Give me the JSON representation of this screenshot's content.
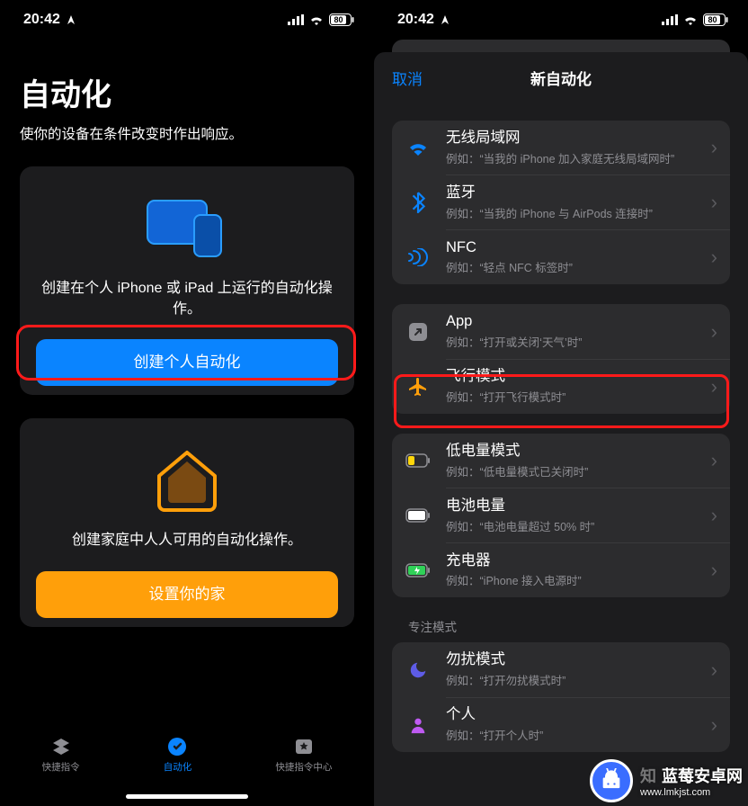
{
  "statusbar": {
    "time": "20:42",
    "battery": "80"
  },
  "left": {
    "title": "自动化",
    "subtitle": "使你的设备在条件改变时作出响应。",
    "card1": {
      "text": "创建在个人 iPhone 或 iPad 上运行的自动化操作。",
      "button": "创建个人自动化"
    },
    "card2": {
      "text": "创建家庭中人人可用的自动化操作。",
      "button": "设置你的家"
    },
    "tabs": {
      "t1": "快捷指令",
      "t2": "自动化",
      "t3": "快捷指令中心"
    }
  },
  "right": {
    "cancel": "取消",
    "title": "新自动化",
    "rows": {
      "wifi": {
        "title": "无线局域网",
        "sub": "例如：“当我的 iPhone 加入家庭无线局域网时”"
      },
      "bt": {
        "title": "蓝牙",
        "sub": "例如：“当我的 iPhone 与 AirPods 连接时”"
      },
      "nfc": {
        "title": "NFC",
        "sub": "例如：“轻点 NFC 标签时”"
      },
      "app": {
        "title": "App",
        "sub": "例如：“打开或关闭‘天气’时”"
      },
      "airplane": {
        "title": "飞行模式",
        "sub": "例如：“打开飞行模式时”"
      },
      "lowpower": {
        "title": "低电量模式",
        "sub": "例如：“低电量模式已关闭时”"
      },
      "battery": {
        "title": "电池电量",
        "sub": "例如：“电池电量超过 50% 时”"
      },
      "charger": {
        "title": "充电器",
        "sub": "例如：“iPhone 接入电源时”"
      },
      "dnd": {
        "title": "勿扰模式",
        "sub": "例如：“打开勿扰模式时”"
      },
      "personal": {
        "title": "个人",
        "sub": "例如：“打开个人时”"
      }
    },
    "section_focus": "专注模式"
  },
  "watermark": {
    "brand_partial": "知",
    "brand_full": "蓝莓安卓网",
    "url": "www.lmkjst.com"
  }
}
